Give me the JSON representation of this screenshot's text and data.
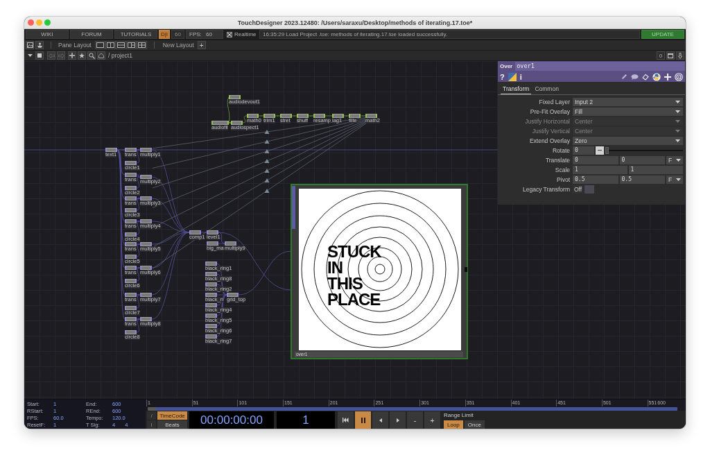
{
  "window": {
    "title": "TouchDesigner 2023.12480: /Users/saraxu/Desktop/methods of iterating.17.toe*"
  },
  "menu_bar": {
    "links": [
      {
        "label": "WIKI"
      },
      {
        "label": "FORUM"
      },
      {
        "label": "TUTORIALS"
      }
    ],
    "perform_toggle": {
      "label": "D|I",
      "on": true
    },
    "fps_cap": {
      "value": "60",
      "disabled": true
    },
    "fps": "FPS: 60",
    "realtime": {
      "label": "Realtime",
      "checked": true
    },
    "message": "16:35:29 Load Project .toe: methods of iterating.17.toe loaded successfully.",
    "update_button": "UPDATE"
  },
  "pane_bar": {
    "pane_layout_label": "Pane Layout",
    "new_layout_label": "New Layout",
    "add_button": "+"
  },
  "path_bar": {
    "path": "/ project1",
    "counter": "0"
  },
  "network": {
    "nodes": [
      {
        "label": "audiodevout1",
        "kind": "chop"
      },
      {
        "label": "math0",
        "kind": "chop"
      },
      {
        "label": "trim1",
        "kind": "chop"
      },
      {
        "label": "stret",
        "kind": "chop"
      },
      {
        "label": "shuff",
        "kind": "chop"
      },
      {
        "label": "resamp",
        "kind": "chop"
      },
      {
        "label": "lag1",
        "kind": "chop"
      },
      {
        "label": "filte",
        "kind": "chop"
      },
      {
        "label": "math2",
        "kind": "chop"
      },
      {
        "label": "audiofil",
        "kind": "chop"
      },
      {
        "label": "audiospect1",
        "kind": "chop"
      },
      {
        "label": "text1",
        "kind": "top"
      },
      {
        "label": "trans",
        "kind": "top"
      },
      {
        "label": "multiply1",
        "kind": "top"
      },
      {
        "label": "circle1",
        "kind": "top"
      },
      {
        "label": "trans",
        "kind": "top"
      },
      {
        "label": "multiply2",
        "kind": "top"
      },
      {
        "label": "circle2",
        "kind": "top"
      },
      {
        "label": "trans",
        "kind": "top"
      },
      {
        "label": "multiply3",
        "kind": "top"
      },
      {
        "label": "circle3",
        "kind": "top"
      },
      {
        "label": "trans",
        "kind": "top"
      },
      {
        "label": "multiply4",
        "kind": "top"
      },
      {
        "label": "circle4",
        "kind": "top"
      },
      {
        "label": "trans",
        "kind": "top"
      },
      {
        "label": "multiply5",
        "kind": "top"
      },
      {
        "label": "circle5",
        "kind": "top"
      },
      {
        "label": "trans",
        "kind": "top"
      },
      {
        "label": "multiply6",
        "kind": "top"
      },
      {
        "label": "circle6",
        "kind": "top"
      },
      {
        "label": "trans",
        "kind": "top"
      },
      {
        "label": "multiply7",
        "kind": "top"
      },
      {
        "label": "circle7",
        "kind": "top"
      },
      {
        "label": "trans",
        "kind": "top"
      },
      {
        "label": "multiply8",
        "kind": "top"
      },
      {
        "label": "circle8",
        "kind": "top"
      },
      {
        "label": "comp1",
        "kind": "top"
      },
      {
        "label": "level1",
        "kind": "top"
      },
      {
        "label": "big_ma",
        "kind": "top"
      },
      {
        "label": "multiply9",
        "kind": "top"
      },
      {
        "label": "black_ring1",
        "kind": "top"
      },
      {
        "label": "black_ring8",
        "kind": "top"
      },
      {
        "label": "black_ring2",
        "kind": "top"
      },
      {
        "label": "black_ri",
        "kind": "top"
      },
      {
        "label": "grid_top",
        "kind": "top"
      },
      {
        "label": "black_ring4",
        "kind": "top"
      },
      {
        "label": "black_ring5",
        "kind": "top"
      },
      {
        "label": "black_ring6",
        "kind": "top"
      },
      {
        "label": "black_ring7",
        "kind": "top"
      }
    ]
  },
  "viewer": {
    "label": "over1",
    "image_text": [
      "STUCK",
      "IN",
      "THIS",
      "PLACE"
    ]
  },
  "parameters": {
    "operator_type": "Over",
    "name": "over1",
    "help": "?",
    "info": "i",
    "tabs": [
      {
        "label": "Transform",
        "selected": true
      },
      {
        "label": "Common",
        "selected": false
      }
    ],
    "rows": [
      {
        "kind": "menu",
        "label": "Fixed Layer",
        "value": "Input 2",
        "disabled": false
      },
      {
        "kind": "menu",
        "label": "Pre-Fit Overlay",
        "value": "Fill",
        "disabled": false
      },
      {
        "kind": "menu",
        "label": "Justify Horizontal",
        "value": "Center",
        "disabled": true
      },
      {
        "kind": "menu",
        "label": "Justify Vertical",
        "value": "Center",
        "disabled": true
      },
      {
        "kind": "menu",
        "label": "Extend Overlay",
        "value": "Zero",
        "disabled": false
      },
      {
        "kind": "slider",
        "label": "Rotate",
        "value": "0",
        "level": 0,
        "disabled": false
      },
      {
        "kind": "pair",
        "label": "Translate",
        "values": [
          "0",
          "0"
        ],
        "unit": "F",
        "disabled": false
      },
      {
        "kind": "pair",
        "label": "Scale",
        "values": [
          "1",
          "1"
        ],
        "disabled": false
      },
      {
        "kind": "pair",
        "label": "Pivot",
        "values": [
          "0.5",
          "0.5"
        ],
        "unit": "F",
        "disabled": false
      },
      {
        "kind": "toggle",
        "label": "Legacy Transform",
        "value": "Off",
        "on": false,
        "disabled": false
      }
    ]
  },
  "timeline": {
    "range_info": [
      {
        "label": "Start:",
        "values": [
          "1"
        ]
      },
      {
        "label": "End:",
        "values": [
          "600"
        ]
      },
      {
        "label": "RStart:",
        "values": [
          "1"
        ]
      },
      {
        "label": "REnd:",
        "values": [
          "600"
        ]
      },
      {
        "label": "FPS:",
        "values": [
          "60.0"
        ]
      },
      {
        "label": "Tempo:",
        "values": [
          "120.0"
        ]
      },
      {
        "label": "ResetF:",
        "values": [
          "1"
        ]
      },
      {
        "label": "T Sig:",
        "values": [
          "4",
          "4"
        ]
      }
    ],
    "ruler_ticks": [
      "1",
      "51",
      "101",
      "151",
      "201",
      "251",
      "301",
      "351",
      "401",
      "451",
      "501",
      "551",
      "600"
    ],
    "side_buttons": [
      "/",
      "I"
    ],
    "time_modes": [
      {
        "label": "TimeCode",
        "selected": true
      },
      {
        "label": "Beats",
        "selected": false
      }
    ],
    "timecode": "00:00:00:00",
    "frame": "1",
    "controls": [
      {
        "kind": "skip_start",
        "on": false
      },
      {
        "kind": "pause",
        "on": true
      },
      {
        "kind": "step_back",
        "on": false
      },
      {
        "kind": "step_forward",
        "on": false
      },
      {
        "kind": "text",
        "label": "-",
        "on": false
      },
      {
        "kind": "text",
        "label": "+",
        "on": false
      }
    ],
    "range_limit": {
      "label": "Range Limit",
      "options": [
        {
          "label": "Loop",
          "selected": true
        },
        {
          "label": "Once",
          "selected": false
        }
      ]
    }
  }
}
